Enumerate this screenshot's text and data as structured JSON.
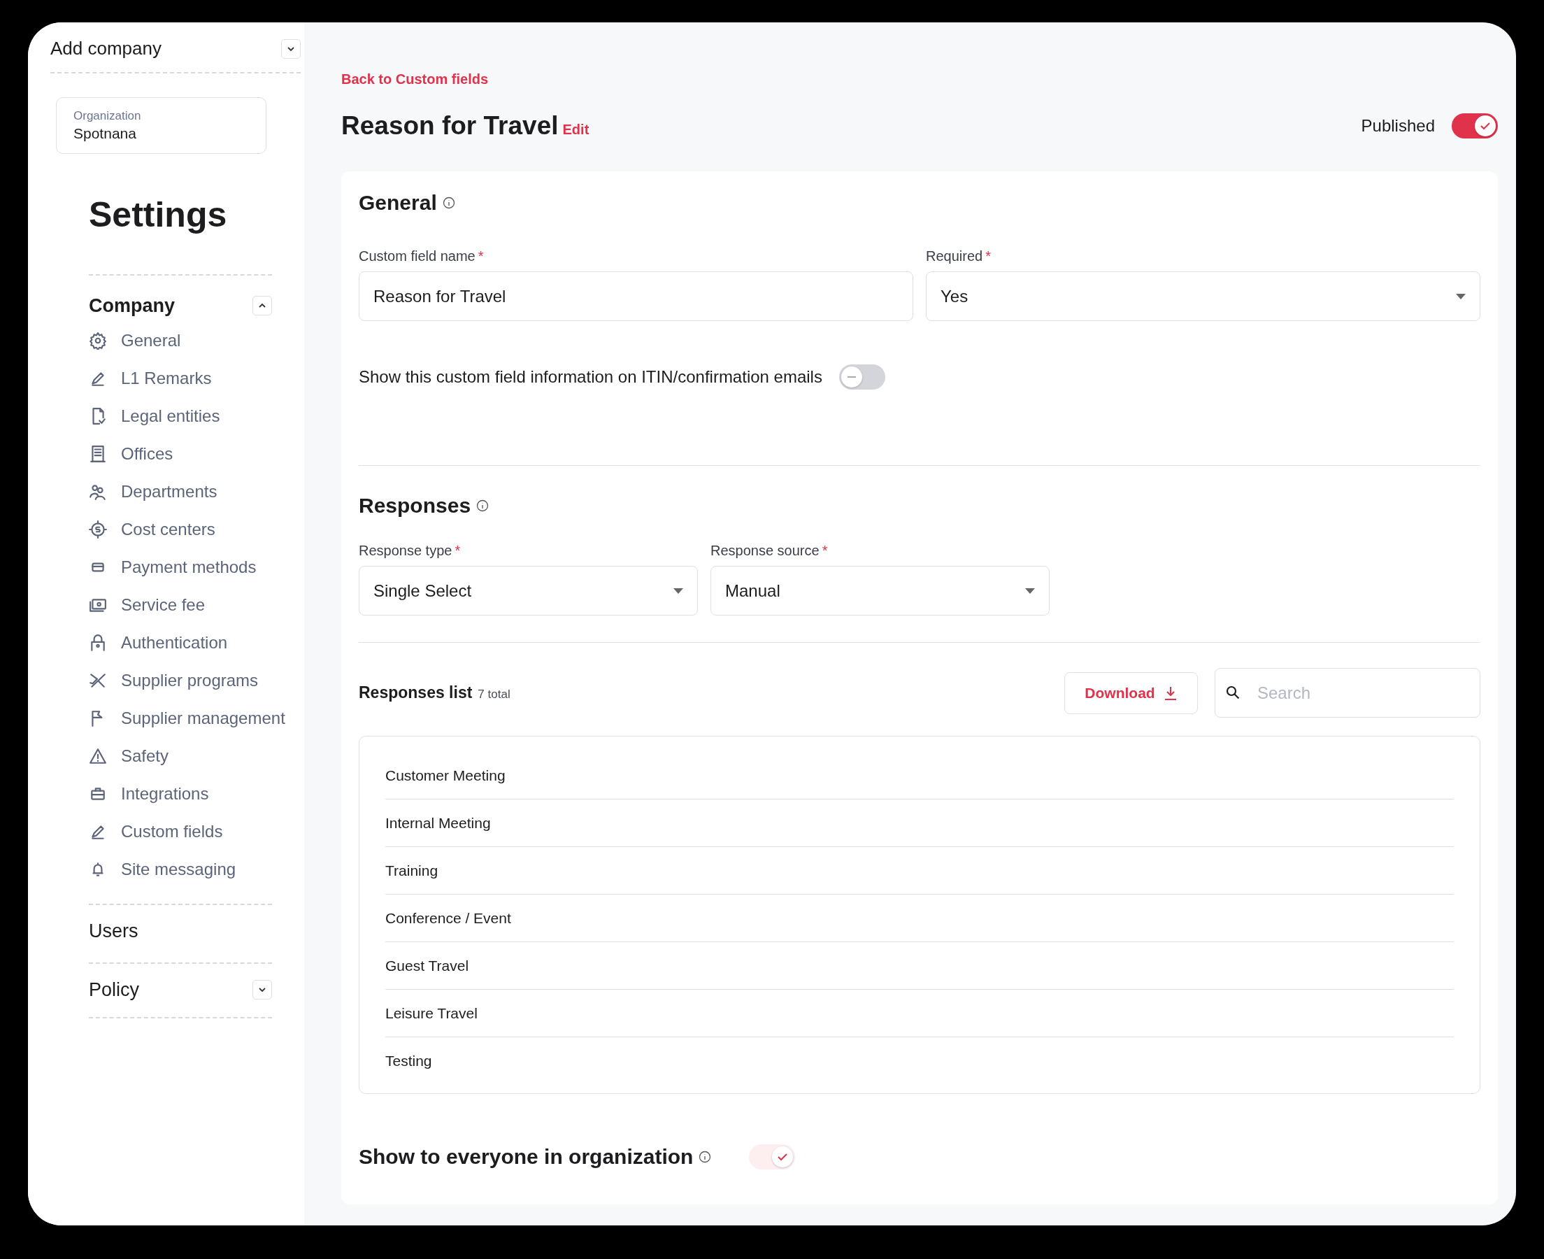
{
  "sidebar": {
    "company_picker": {
      "label": "Add company",
      "expanded": false
    },
    "organization": {
      "label": "Organization",
      "value": "Spotnana"
    },
    "title": "Settings",
    "sections": [
      {
        "label": "Company",
        "expanded": true,
        "items": [
          {
            "label": "General"
          },
          {
            "label": "L1 Remarks"
          },
          {
            "label": "Legal entities"
          },
          {
            "label": "Offices"
          },
          {
            "label": "Departments"
          },
          {
            "label": "Cost centers"
          },
          {
            "label": "Payment methods"
          },
          {
            "label": "Service fee"
          },
          {
            "label": "Authentication"
          },
          {
            "label": "Supplier programs"
          },
          {
            "label": "Supplier management"
          },
          {
            "label": "Safety"
          },
          {
            "label": "Integrations"
          },
          {
            "label": "Custom fields"
          },
          {
            "label": "Site messaging"
          }
        ]
      },
      {
        "label": "Users"
      },
      {
        "label": "Policy",
        "expanded": false
      }
    ]
  },
  "header": {
    "back_link": "Back to Custom fields",
    "title": "Reason for Travel",
    "edit_link": "Edit",
    "published": {
      "label": "Published",
      "on": true
    }
  },
  "general": {
    "title": "General",
    "fields": [
      {
        "label": "Custom field name",
        "required_mark": "*",
        "value": "Reason for Travel",
        "kind": "input"
      },
      {
        "label": "Required",
        "required_mark": "*",
        "value": "Yes",
        "kind": "select"
      }
    ],
    "email_toggle": {
      "label": "Show this custom field information on ITIN/confirmation emails",
      "on": false
    }
  },
  "responses": {
    "title": "Responses",
    "fields": [
      {
        "label": "Response type",
        "required_mark": "*",
        "value": "Single Select",
        "kind": "select"
      },
      {
        "label": "Response source",
        "required_mark": "*",
        "value": "Manual",
        "kind": "select"
      }
    ],
    "list": {
      "title": "Responses list",
      "count": "7 total",
      "download": "Download",
      "search_placeholder": "Search",
      "items": [
        "Customer Meeting",
        "Internal Meeting",
        "Training",
        "Conference / Event",
        "Guest Travel",
        "Leisure Travel",
        "Testing"
      ]
    }
  },
  "visibility": {
    "label": "Show to everyone in organization",
    "on": true,
    "disabled": true
  }
}
